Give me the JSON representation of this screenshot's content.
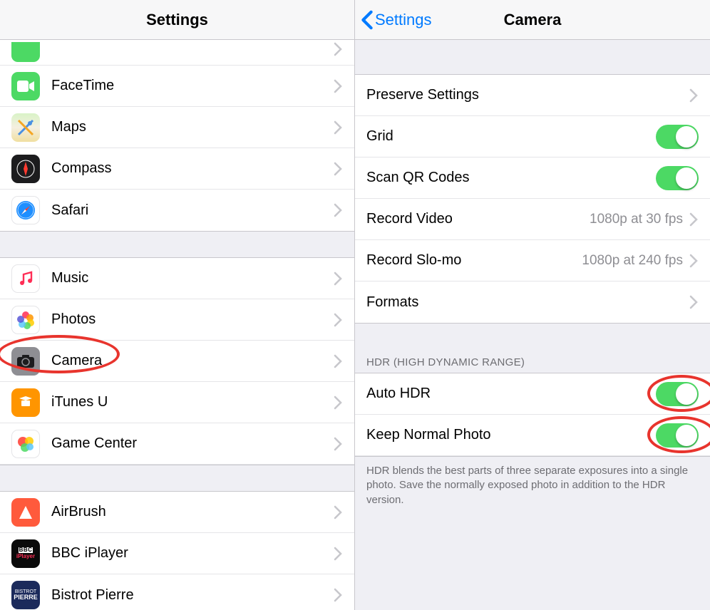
{
  "left": {
    "title": "Settings",
    "group1": [
      {
        "label": "FaceTime",
        "icon": "facetime",
        "bg": "#4cd964"
      },
      {
        "label": "Maps",
        "icon": "maps",
        "bg": "#ffffff"
      },
      {
        "label": "Compass",
        "icon": "compass",
        "bg": "#1c1c1e"
      },
      {
        "label": "Safari",
        "icon": "safari",
        "bg": "#ffffff"
      }
    ],
    "group2": [
      {
        "label": "Music",
        "icon": "music",
        "bg": "#ffffff"
      },
      {
        "label": "Photos",
        "icon": "photos",
        "bg": "#ffffff"
      },
      {
        "label": "Camera",
        "icon": "camera",
        "bg": "#8e8e93"
      },
      {
        "label": "iTunes U",
        "icon": "itunesu",
        "bg": "#ff9500"
      },
      {
        "label": "Game Center",
        "icon": "gamecenter",
        "bg": "#ffffff"
      }
    ],
    "group3": [
      {
        "label": "AirBrush",
        "icon": "airbrush",
        "bg": "#ff5a3c"
      },
      {
        "label": "BBC iPlayer",
        "icon": "bbc",
        "bg": "#0a0a0a"
      },
      {
        "label": "Bistrot Pierre",
        "icon": "bistrot",
        "bg": "#1b2a5b"
      }
    ]
  },
  "right": {
    "back_label": "Settings",
    "title": "Camera",
    "rows1": {
      "preserve": "Preserve Settings",
      "grid": "Grid",
      "scanqr": "Scan QR Codes",
      "rec_video": {
        "label": "Record Video",
        "value": "1080p at 30 fps"
      },
      "rec_slomo": {
        "label": "Record Slo-mo",
        "value": "1080p at 240 fps"
      },
      "formats": "Formats"
    },
    "section_hdr": "HDR (HIGH DYNAMIC RANGE)",
    "rows2": {
      "auto_hdr": "Auto HDR",
      "keep_normal": "Keep Normal Photo"
    },
    "footer": "HDR blends the best parts of three separate exposures into a single photo. Save the normally exposed photo in addition to the HDR version."
  }
}
